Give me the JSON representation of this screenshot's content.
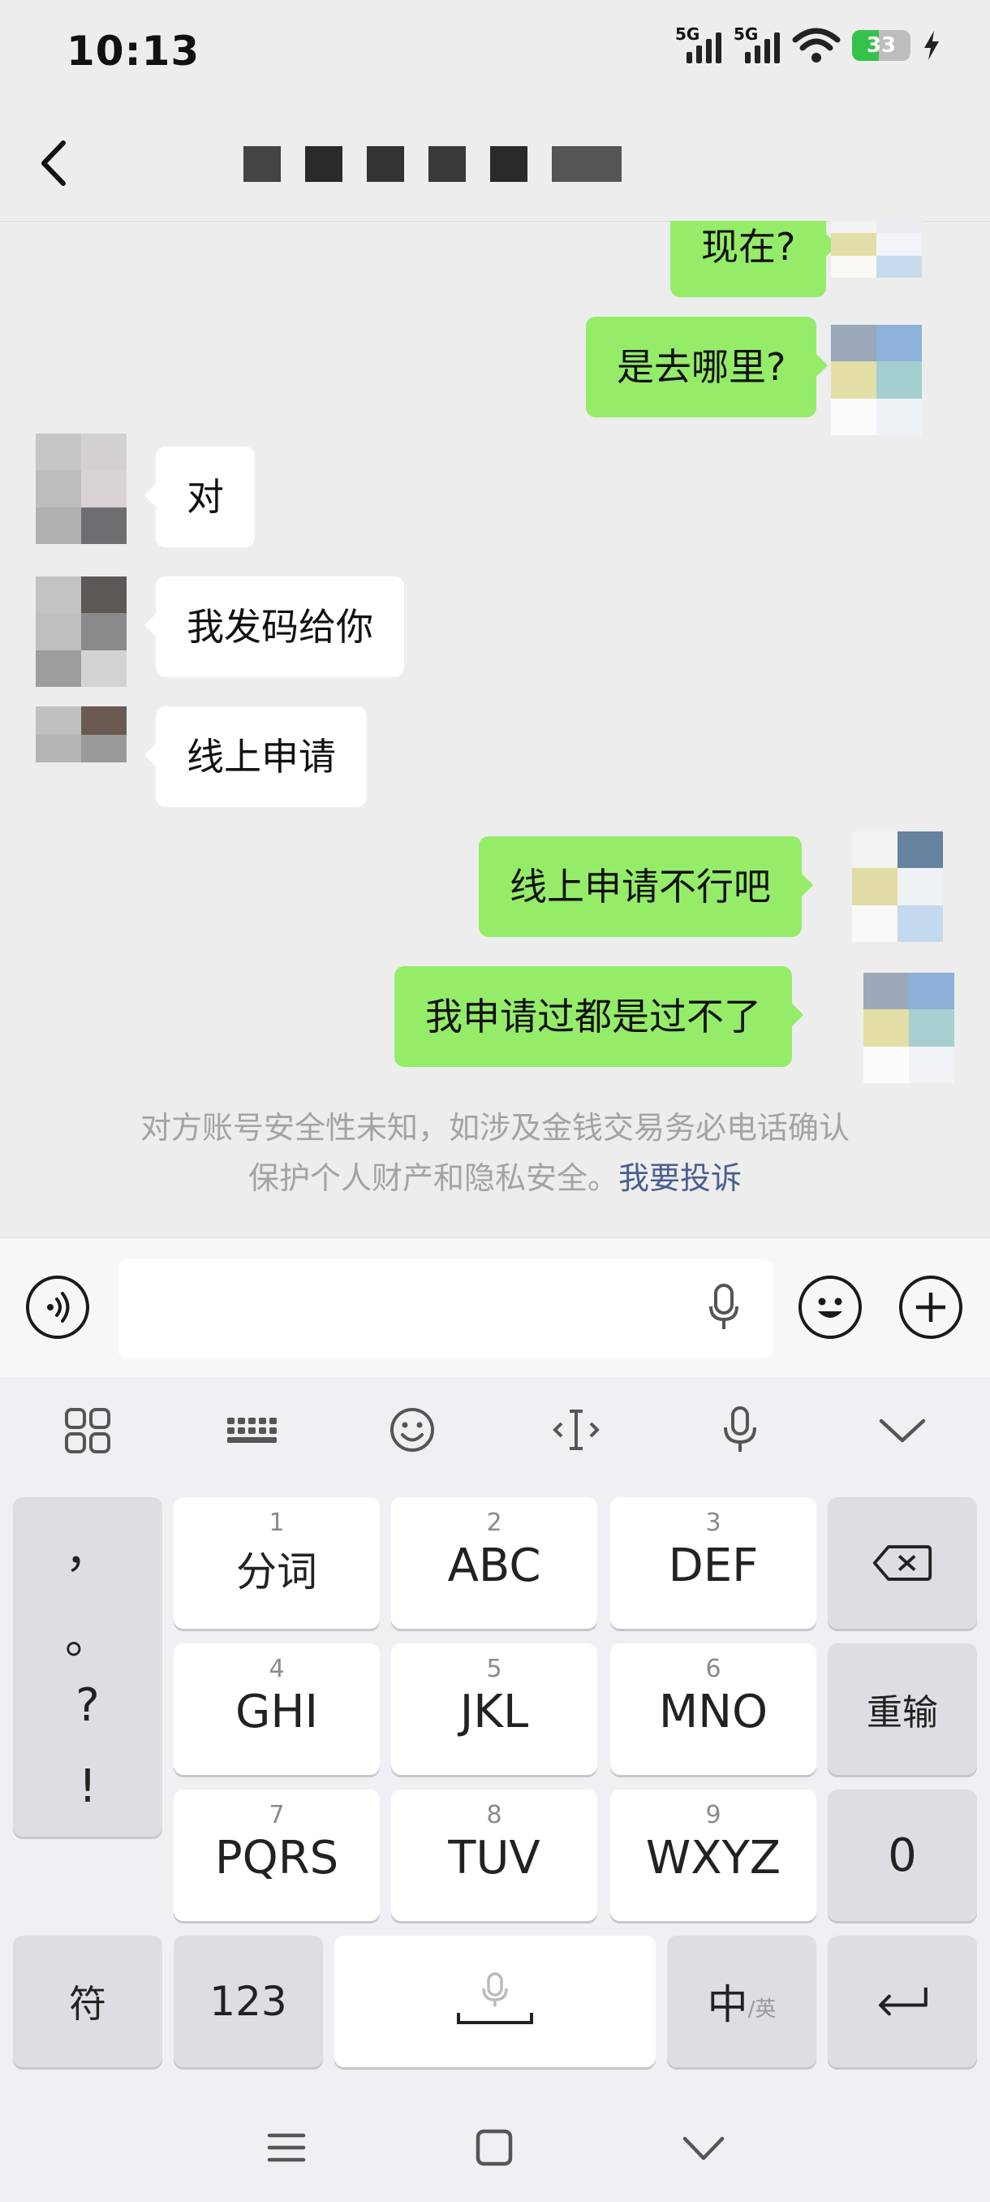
{
  "status_bar": {
    "time": "10:13",
    "signal_labels": [
      "5G",
      "5G"
    ],
    "battery_level": "33",
    "icons": [
      "signal-5g-icon",
      "signal-5g-icon",
      "wifi-icon",
      "battery-icon",
      "charging-icon"
    ]
  },
  "header": {
    "back_icon": "chevron-left-icon",
    "title_redacted": true
  },
  "messages": [
    {
      "side": "out",
      "text": "现在?"
    },
    {
      "side": "out",
      "text": "是去哪里?"
    },
    {
      "side": "in",
      "text": "对"
    },
    {
      "side": "in",
      "text": "我发码给你"
    },
    {
      "side": "in",
      "text": "线上申请"
    },
    {
      "side": "out",
      "text": "线上申请不行吧"
    },
    {
      "side": "out",
      "text": "我申请过都是过不了"
    }
  ],
  "notice": {
    "line1": "对方账号安全性未知，如涉及金钱交易务必电话确认",
    "line2": "保护个人财产和隐私安全。",
    "link": "我要投诉"
  },
  "input_bar": {
    "value": "",
    "icons": [
      "voice-mode-icon",
      "microphone-icon",
      "emoji-icon",
      "plus-icon"
    ]
  },
  "keyboard": {
    "toolbar_icons": [
      "grid-menu-icon",
      "keyboard-icon",
      "emoji-icon",
      "cursor-icon",
      "microphone-icon",
      "chevron-down-icon"
    ],
    "punctuation": [
      "，",
      "。",
      "?",
      "!"
    ],
    "keys": [
      {
        "num": "1",
        "label": "分词"
      },
      {
        "num": "2",
        "label": "ABC"
      },
      {
        "num": "3",
        "label": "DEF"
      },
      {
        "num": "4",
        "label": "GHI"
      },
      {
        "num": "5",
        "label": "JKL"
      },
      {
        "num": "6",
        "label": "MNO"
      },
      {
        "num": "7",
        "label": "PQRS"
      },
      {
        "num": "8",
        "label": "TUV"
      },
      {
        "num": "9",
        "label": "WXYZ"
      }
    ],
    "right_keys": {
      "backspace_icon": "backspace-icon",
      "reenter": "重输",
      "zero": "0",
      "enter_icon": "enter-icon"
    },
    "bottom": {
      "symbols": "符",
      "numbers": "123",
      "lang_main": "中",
      "lang_alt": "/英",
      "space_icon": "space-mic-icon"
    }
  },
  "nav_bar": {
    "icons": [
      "menu-icon",
      "home-icon",
      "back-chevron-icon"
    ]
  }
}
